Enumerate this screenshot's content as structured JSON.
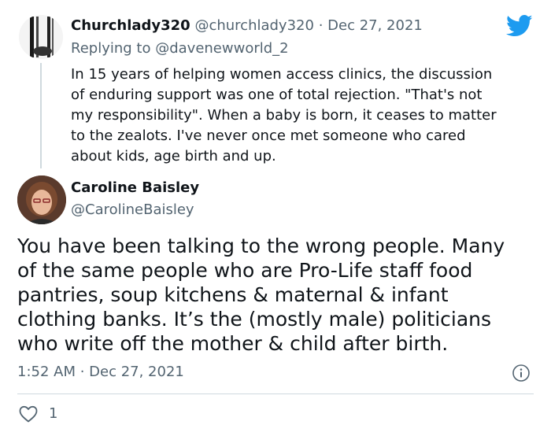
{
  "parent_tweet": {
    "display_name": "Churchlady320",
    "handle": "@churchlady320",
    "separator": "·",
    "date": "Dec 27, 2021",
    "replying_to_prefix": "Replying to",
    "replying_to_handle": "@davenewworld_2",
    "text": "In 15 years of helping women access clinics, the discussion\nof enduring support was one of total rejection. \"That's not\nmy responsibility\". When a baby is born, it ceases to matter\nto the zealots. I've never once met someone who cared\nabout kids, age birth and up."
  },
  "main_tweet": {
    "display_name": "Caroline Baisley",
    "handle": "@CarolineBaisley",
    "text": "You have been talking to the wrong people. Many\nof the same people who are Pro-Life staff food\npantries, soup kitchens & maternal & infant\nclothing banks. It’s the (mostly male) politicians\nwho write off the mother & child after birth.",
    "timestamp": "1:52 AM · Dec 27, 2021",
    "like_count": "1"
  },
  "icons": {
    "brand": "twitter-bird-icon",
    "info": "info-icon",
    "like": "heart-icon"
  },
  "colors": {
    "brand_blue": "#1d9bf0",
    "text_primary": "#0f1419",
    "text_secondary": "#536471",
    "divider": "#cfd9de"
  }
}
